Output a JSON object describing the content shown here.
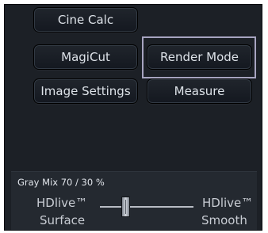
{
  "buttons": {
    "cine_calc": "Cine Calc",
    "magicut": "MagiCut",
    "render_mode": "Render Mode",
    "image_settings": "Image Settings",
    "measure": "Measure"
  },
  "selected_button": "Render Mode",
  "gray_mix": {
    "title": "Gray Mix 70 / 30 %",
    "left_label_line1": "HDlive™",
    "left_label_line2": "Surface",
    "right_label_line1": "HDlive™",
    "right_label_line2": "Smooth",
    "slider_value_percent": 30
  },
  "colors": {
    "panel_bg": "#1c2026",
    "selection_frame": "#a7a4c0",
    "text": "#dde2e8"
  }
}
